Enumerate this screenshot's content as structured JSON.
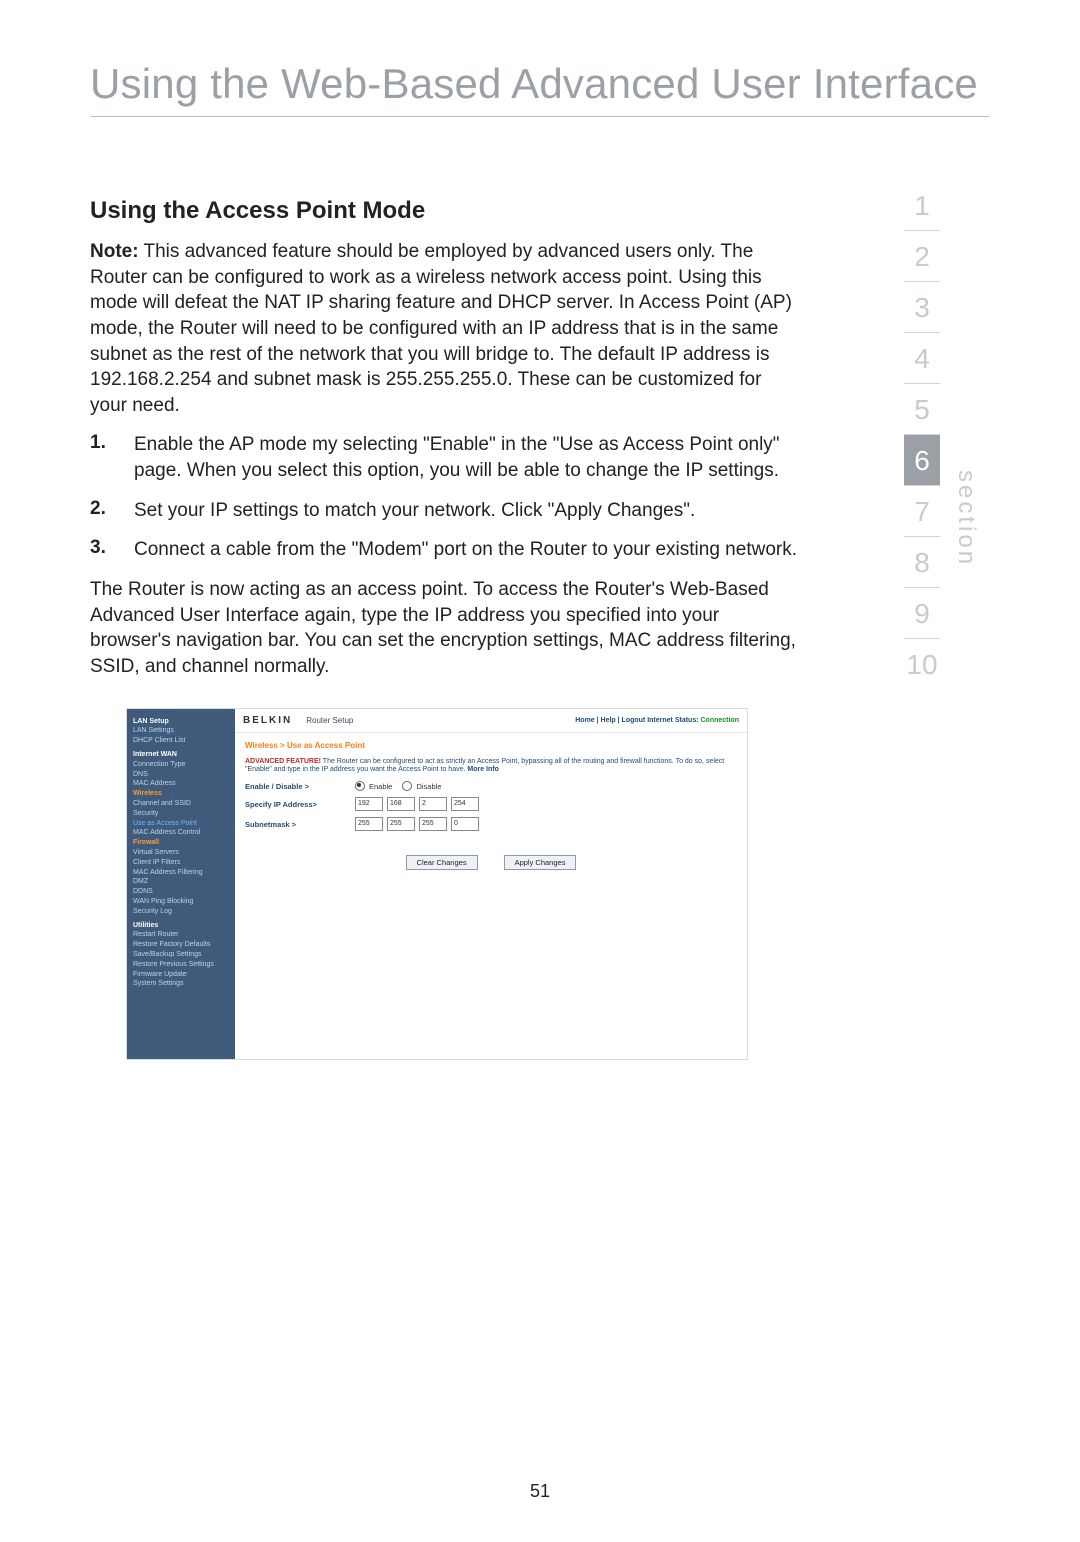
{
  "chapter_title": "Using the Web-Based Advanced User Interface",
  "section_heading": "Using the Access Point Mode",
  "note_label": "Note:",
  "note_para": " This advanced feature should be employed by advanced users only. The Router can be configured to work as a wireless network access point. Using this mode will defeat the NAT IP sharing feature and DHCP server. In Access Point (AP) mode, the Router will need to be configured with an IP address that is in the same subnet as the rest of the network that you will bridge to. The default IP address is 192.168.2.254 and subnet mask is 255.255.255.0. These can be customized for your need.",
  "steps": [
    {
      "num": "1.",
      "text": "Enable the AP mode my selecting \"Enable\" in the \"Use as Access Point only\" page. When you select this option, you will be able to change the IP settings."
    },
    {
      "num": "2.",
      "text": "Set your IP settings to match your network. Click \"Apply Changes\"."
    },
    {
      "num": "3.",
      "text": "Connect a cable from the \"Modem\" port on the Router to your existing network."
    }
  ],
  "closing_para": "The Router is now acting as an access point. To access the Router's Web-Based Advanced User Interface again, type the IP address you specified into your browser's navigation bar. You can set the encryption settings, MAC address filtering, SSID, and channel normally.",
  "page_number": "51",
  "section_word": "section",
  "section_numbers": [
    "1",
    "2",
    "3",
    "4",
    "5",
    "6",
    "7",
    "8",
    "9",
    "10"
  ],
  "section_active_index": 5,
  "router": {
    "brand": "BELKIN",
    "title": "Router Setup",
    "toplinks": "Home | Help | Logout   Internet Status:",
    "status_value": "Connection",
    "breadcrumb": "Wireless > Use as Access Point",
    "feature_label": "ADVANCED FEATURE!",
    "feature_text": " The Router can be configured to act as strictly an Access Point, bypassing all of the routing and firewall functions. To do so, select \"Enable\" and type in the IP address you want the Access Point to have. ",
    "more_info": "More Info",
    "labels": {
      "enable": "Enable / Disable >",
      "enable_opt": "Enable",
      "disable_opt": "Disable",
      "ip": "Specify IP Address>",
      "mask": "Subnetmask >"
    },
    "ip": [
      "192",
      "168",
      "2",
      "254"
    ],
    "mask": [
      "255",
      "255",
      "255",
      "0"
    ],
    "buttons": {
      "clear": "Clear Changes",
      "apply": "Apply Changes"
    },
    "sidebar": [
      {
        "t": "LAN Setup",
        "c": "cat"
      },
      {
        "t": "LAN Settings",
        "c": "item"
      },
      {
        "t": "DHCP Client List",
        "c": "item"
      },
      {
        "t": "Internet WAN",
        "c": "cat"
      },
      {
        "t": "Connection Type",
        "c": "item"
      },
      {
        "t": "DNS",
        "c": "item"
      },
      {
        "t": "MAC Address",
        "c": "item"
      },
      {
        "t": "Wireless",
        "c": "orange"
      },
      {
        "t": "Channel and SSID",
        "c": "item"
      },
      {
        "t": "Security",
        "c": "item"
      },
      {
        "t": "Use as Access Point",
        "c": "active"
      },
      {
        "t": "MAC Address Control",
        "c": "item"
      },
      {
        "t": "Firewall",
        "c": "orange"
      },
      {
        "t": "Virtual Servers",
        "c": "item"
      },
      {
        "t": "Client IP Filters",
        "c": "item"
      },
      {
        "t": "MAC Address Filtering",
        "c": "item"
      },
      {
        "t": "DMZ",
        "c": "item"
      },
      {
        "t": "DDNS",
        "c": "item"
      },
      {
        "t": "WAN Ping Blocking",
        "c": "item"
      },
      {
        "t": "Security Log",
        "c": "item"
      },
      {
        "t": "Utilities",
        "c": "cat"
      },
      {
        "t": "Restart Router",
        "c": "item"
      },
      {
        "t": "Restore Factory Defaults",
        "c": "item"
      },
      {
        "t": "Save/Backup Settings",
        "c": "item"
      },
      {
        "t": "Restore Previous Settings",
        "c": "item"
      },
      {
        "t": "Firmware Update",
        "c": "item"
      },
      {
        "t": "System Settings",
        "c": "item"
      }
    ]
  }
}
